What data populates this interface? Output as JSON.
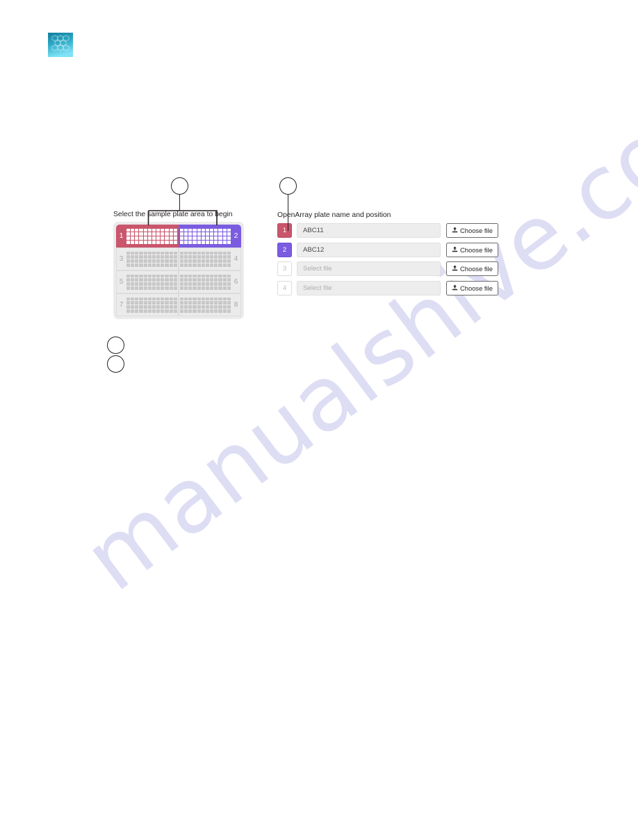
{
  "branding": {
    "logo_icon": "thermo-fisher-hex-logo",
    "logo_colors": [
      "#1a8fa8",
      "#6fd8ef",
      "#0f7a97"
    ]
  },
  "watermark": {
    "text": "manualshive.com",
    "color": "#c9c9ee"
  },
  "callouts": [
    {
      "id": "callout-1",
      "label": "",
      "target": "sample-plate-selector"
    },
    {
      "id": "callout-2",
      "label": "",
      "target": "openarray-plate-name-position"
    },
    {
      "id": "callout-3",
      "label": "",
      "target": ""
    },
    {
      "id": "callout-4",
      "label": "",
      "target": ""
    }
  ],
  "plate_selector": {
    "heading": "Select the sample plate area to begin",
    "wells_per_quadrant": {
      "columns": 12,
      "rows": 4
    },
    "quadrants": [
      {
        "number": "1",
        "state": "selected",
        "color": "#c9566c",
        "side": "left"
      },
      {
        "number": "2",
        "state": "selected",
        "color": "#7b5ce0",
        "side": "right"
      },
      {
        "number": "3",
        "state": "empty",
        "color": "#ebebeb",
        "side": "left"
      },
      {
        "number": "4",
        "state": "empty",
        "color": "#ebebeb",
        "side": "right"
      },
      {
        "number": "5",
        "state": "empty",
        "color": "#ebebeb",
        "side": "left"
      },
      {
        "number": "6",
        "state": "empty",
        "color": "#ebebeb",
        "side": "right"
      },
      {
        "number": "7",
        "state": "empty",
        "color": "#ebebeb",
        "side": "left"
      },
      {
        "number": "8",
        "state": "empty",
        "color": "#ebebeb",
        "side": "right"
      }
    ]
  },
  "plate_names": {
    "heading": "OpenArray plate name and position",
    "choose_file_label": "Choose file",
    "choose_file_icon": "upload-icon",
    "rows": [
      {
        "position": "1",
        "badge_state": "red",
        "value": "ABC11",
        "is_placeholder": false,
        "button_label": "Choose file"
      },
      {
        "position": "2",
        "badge_state": "purple",
        "value": "ABC12",
        "is_placeholder": false,
        "button_label": "Choose file"
      },
      {
        "position": "3",
        "badge_state": "empty",
        "value": "Select file",
        "is_placeholder": true,
        "button_label": "Choose file"
      },
      {
        "position": "4",
        "badge_state": "empty",
        "value": "Select file",
        "is_placeholder": true,
        "button_label": "Choose file"
      }
    ]
  }
}
